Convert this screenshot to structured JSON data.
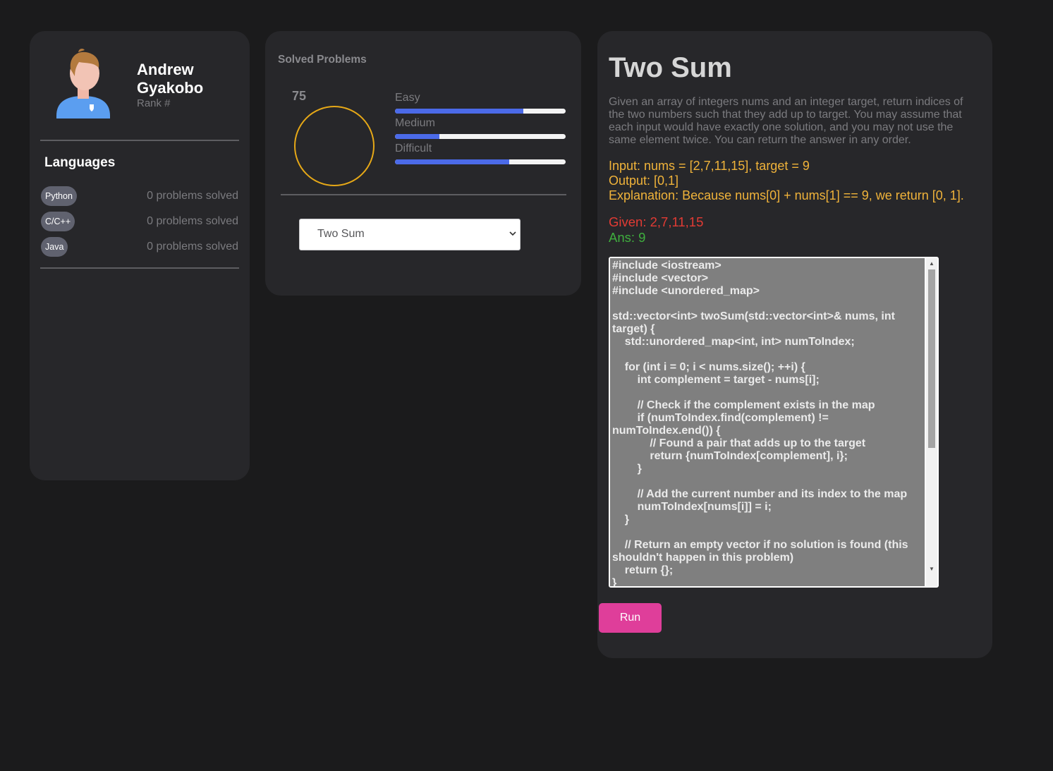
{
  "profile": {
    "name": "Andrew Gyakobo",
    "rank_label": "Rank #",
    "languages_title": "Languages",
    "languages": [
      {
        "name": "Python",
        "solved": "0 problems solved"
      },
      {
        "name": "C/C++",
        "solved": "0 problems solved"
      },
      {
        "name": "Java",
        "solved": "0 problems solved"
      }
    ]
  },
  "solved": {
    "title": "Solved Problems",
    "total": "75",
    "ring_color": "#e6a817",
    "bar_color": "#4b6ae8",
    "difficulties": [
      {
        "label": "Easy",
        "progress": 0.75
      },
      {
        "label": "Medium",
        "progress": 0.26
      },
      {
        "label": "Difficult",
        "progress": 0.67
      }
    ],
    "select_value": "Two Sum"
  },
  "problem": {
    "title": "Two Sum",
    "description": "Given an array of integers nums and an integer target, return indices of the two numbers such that they add up to target. You may assume that each input would have exactly one solution, and you may not use the same element twice. You can return the answer in any order.",
    "input": "Input: nums = [2,7,11,15], target = 9",
    "output": "Output: [0,1]",
    "explanation": "Explanation: Because nums[0] + nums[1] == 9, we return [0, 1].",
    "given": "Given: 2,7,11,15",
    "ans": "Ans: 9",
    "code": "#include <iostream>\n#include <vector>\n#include <unordered_map>\n\nstd::vector<int> twoSum(std::vector<int>& nums, int target) {\n    std::unordered_map<int, int> numToIndex;\n\n    for (int i = 0; i < nums.size(); ++i) {\n        int complement = target - nums[i];\n\n        // Check if the complement exists in the map\n        if (numToIndex.find(complement) != numToIndex.end()) {\n            // Found a pair that adds up to the target\n            return {numToIndex[complement], i};\n        }\n\n        // Add the current number and its index to the map\n        numToIndex[nums[i]] = i;\n    }\n\n    // Return an empty vector if no solution is found (this shouldn't happen in this problem)\n    return {};\n}",
    "run_label": "Run",
    "run_color": "#df3e9a"
  }
}
